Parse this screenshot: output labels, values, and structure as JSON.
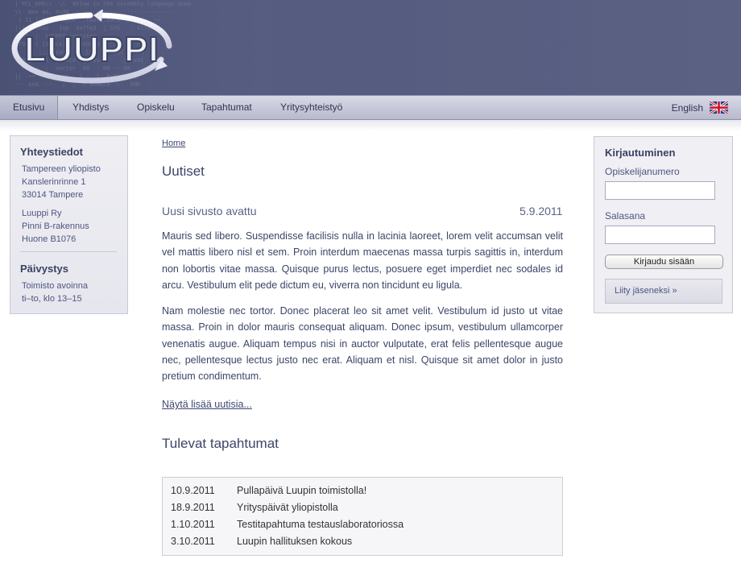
{
  "header": {
    "logo_text": "LUUPPI"
  },
  "nav": {
    "items": [
      {
        "label": "Etusivu"
      },
      {
        "label": "Yhdistys"
      },
      {
        "label": "Opiskelu"
      },
      {
        "label": "Tapahtumat"
      },
      {
        "label": "Yritysyhteistyö"
      }
    ],
    "language_label": "English",
    "language_icon": "uk-flag-icon"
  },
  "left_panel": {
    "contact_title": "Yhteystiedot",
    "contact_lines": [
      "Tampereen yliopisto",
      "Kanslerinrinne 1",
      "33014 Tampere"
    ],
    "org_lines": [
      "Luuppi Ry",
      "Pinni B-rakennus",
      "Huone B1076"
    ],
    "duty_title": "Päivystys",
    "duty_lines": [
      "Toimisto avoinna",
      "ti–to, klo 13–15"
    ]
  },
  "main": {
    "breadcrumb": "Home",
    "page_title": "Uutiset",
    "news": {
      "title": "Uusi sivusto avattu",
      "date": "5.9.2011",
      "paragraphs": [
        "Mauris sed libero. Suspendisse facilisis nulla in lacinia laoreet, lorem velit accumsan velit vel mattis libero nisl et sem. Proin interdum maecenas massa turpis sagittis in, interdum non lobortis vitae massa. Quisque purus lectus, posuere eget imperdiet nec sodales id arcu. Vestibulum elit pede dictum eu, viverra non tincidunt eu ligula.",
        "Nam molestie nec tortor. Donec placerat leo sit amet velit. Vestibulum id justo ut vitae massa. Proin in dolor mauris consequat aliquam. Donec ipsum, vestibulum ullamcorper venenatis augue. Aliquam tempus nisi in auctor vulputate, erat felis pellentesque augue nec, pellentesque lectus justo nec erat. Aliquam et nisl. Quisque sit amet dolor in justo pretium condimentum."
      ]
    },
    "more_news_link": "Näytä lisää uutisia...",
    "events_title": "Tulevat tapahtumat",
    "events": [
      {
        "date": "10.9.2011",
        "name": "Pullapäivä Luupin toimistolla!"
      },
      {
        "date": "18.9.2011",
        "name": "Yrityspäivät yliopistolla"
      },
      {
        "date": "1.10.2011",
        "name": "Testitapahtuma testauslaboratoriossa"
      },
      {
        "date": "3.10.2011",
        "name": "Luupin hallituksen kokous"
      }
    ]
  },
  "login": {
    "title": "Kirjautuminen",
    "student_number_label": "Opiskelijanumero",
    "student_number_value": "",
    "password_label": "Salasana",
    "password_value": "",
    "login_button": "Kirjaudu sisään",
    "join_button": "Liity jäseneksi »"
  },
  "colors": {
    "header_bg": "#555b7e",
    "nav_bg": "#c8cadb",
    "text_accent": "#3d4466"
  }
}
